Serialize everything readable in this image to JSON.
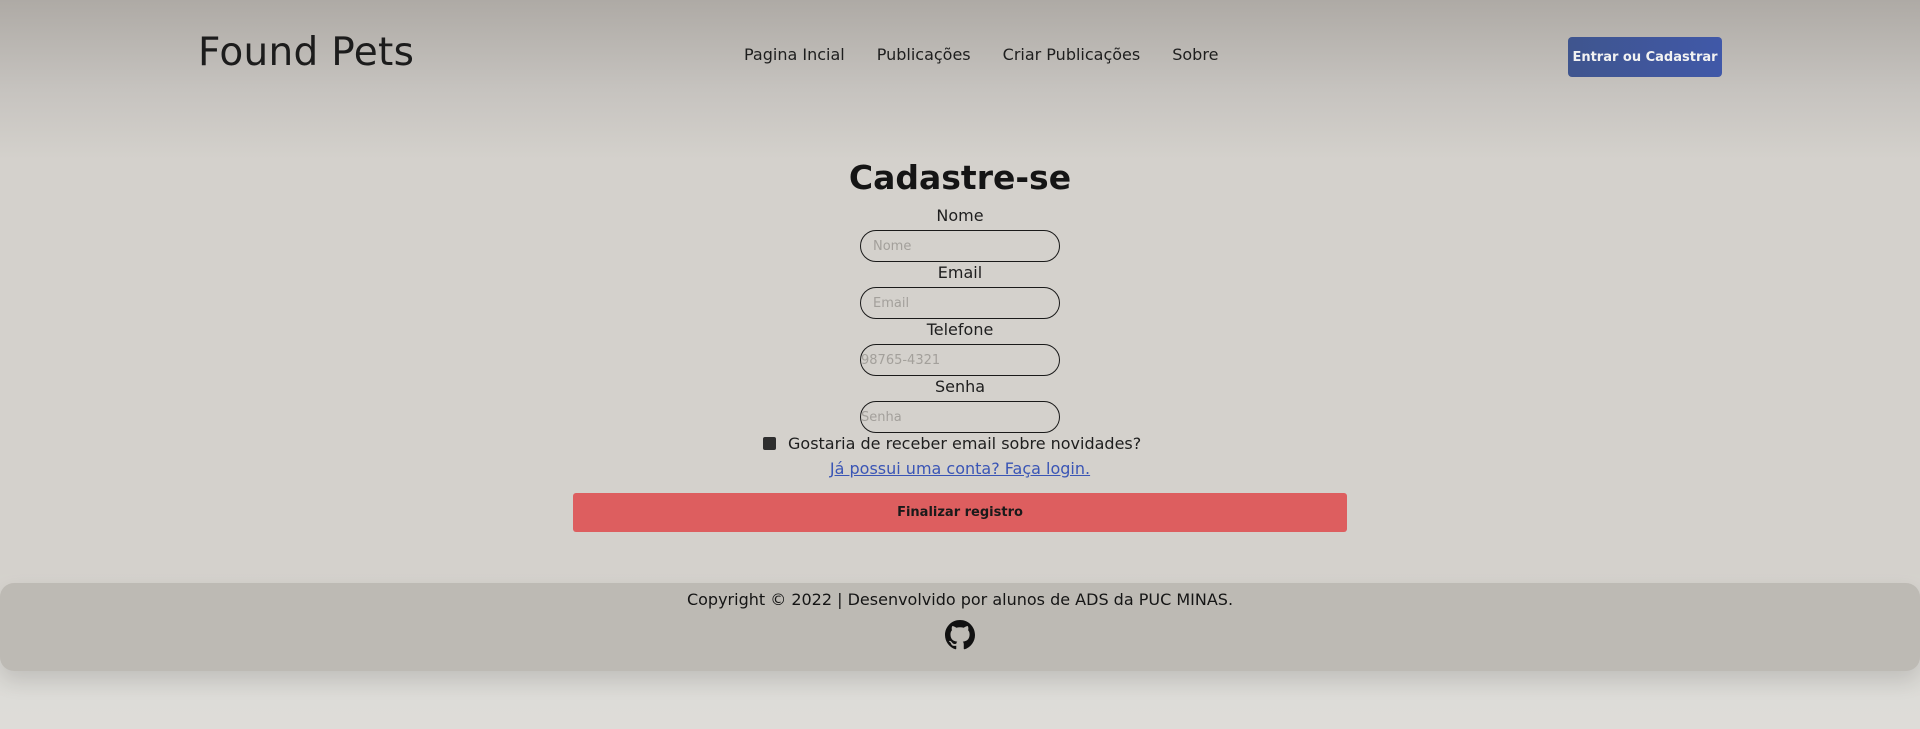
{
  "header": {
    "logo": "Found Pets",
    "nav": [
      "Pagina Incial",
      "Publicações",
      "Criar Publicações",
      "Sobre"
    ],
    "login_button": "Entrar ou Cadastrar"
  },
  "form": {
    "title": "Cadastre-se",
    "fields": [
      {
        "label": "Nome",
        "placeholder": "Nome",
        "value": ""
      },
      {
        "label": "Email",
        "placeholder": "Email",
        "value": ""
      },
      {
        "label": "Telefone",
        "placeholder": "98765-4321",
        "value": ""
      },
      {
        "label": "Senha",
        "placeholder": "Senha",
        "value": ""
      }
    ],
    "newsletter_label": "Gostaria de receber email sobre novidades?",
    "newsletter_checked": false,
    "login_link": "Já possui uma conta? Faça login.",
    "submit_button": "Finalizar registro"
  },
  "footer": {
    "copyright": "Copyright © 2022 | Desenvolvido por alunos de ADS da PUC MINAS.",
    "icon": "github-icon"
  },
  "colors": {
    "accent": "#4058a8",
    "submit": "#dd5e5f",
    "link": "#3a55b5",
    "footer_bg": "#bdbab4"
  }
}
